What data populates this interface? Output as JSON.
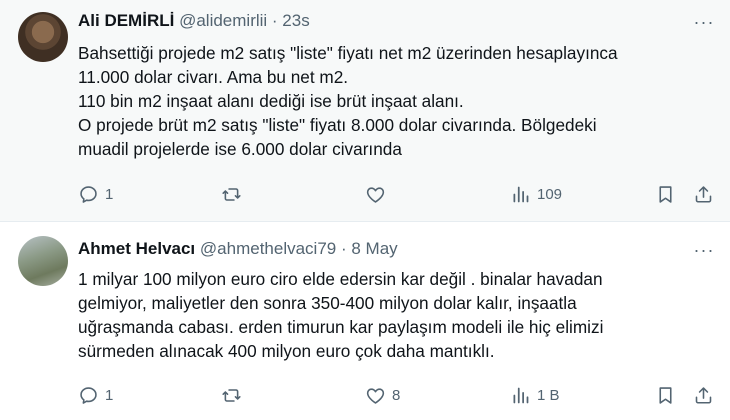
{
  "tweets": [
    {
      "name": "Ali DEMİRLİ",
      "handle": "@alidemirlii",
      "time_sep": " · ",
      "time": "23s",
      "lines": [
        "Bahsettiği projede m2 satış \"liste\" fiyatı net m2 üzerinden hesaplayınca",
        "11.000 dolar civarı. Ama bu net m2.",
        "110 bin m2 inşaat alanı dediği ise brüt inşaat alanı.",
        "O projede brüt m2 satış \"liste\" fiyatı 8.000 dolar civarında. Bölgedeki",
        "muadil projelerde ise 6.000 dolar civarında"
      ],
      "replies": "1",
      "retweets": "",
      "likes": "",
      "views": "109"
    },
    {
      "name": "Ahmet Helvacı",
      "handle": "@ahmethelvaci79",
      "time_sep": " · ",
      "time": "8 May",
      "lines": [
        "1 milyar 100 milyon euro ciro elde edersin kar değil . binalar havadan",
        "gelmiyor, maliyetler den sonra 350-400 milyon dolar kalır, inşaatla",
        "uğraşmanda cabası. erden timurun kar paylaşım modeli ile hiç elimizi",
        "sürmeden alınacak 400 milyon euro çok daha mantıklı."
      ],
      "replies": "1",
      "retweets": "",
      "likes": "8",
      "views": "1 B"
    }
  ],
  "icons": [
    "reply-icon",
    "retweet-icon",
    "like-icon",
    "views-icon",
    "bookmark-icon",
    "share-icon",
    "more-icon"
  ],
  "colors": {
    "meta": "#536471",
    "text": "#0f1419",
    "highlight_bg": "#f7f9f9"
  }
}
